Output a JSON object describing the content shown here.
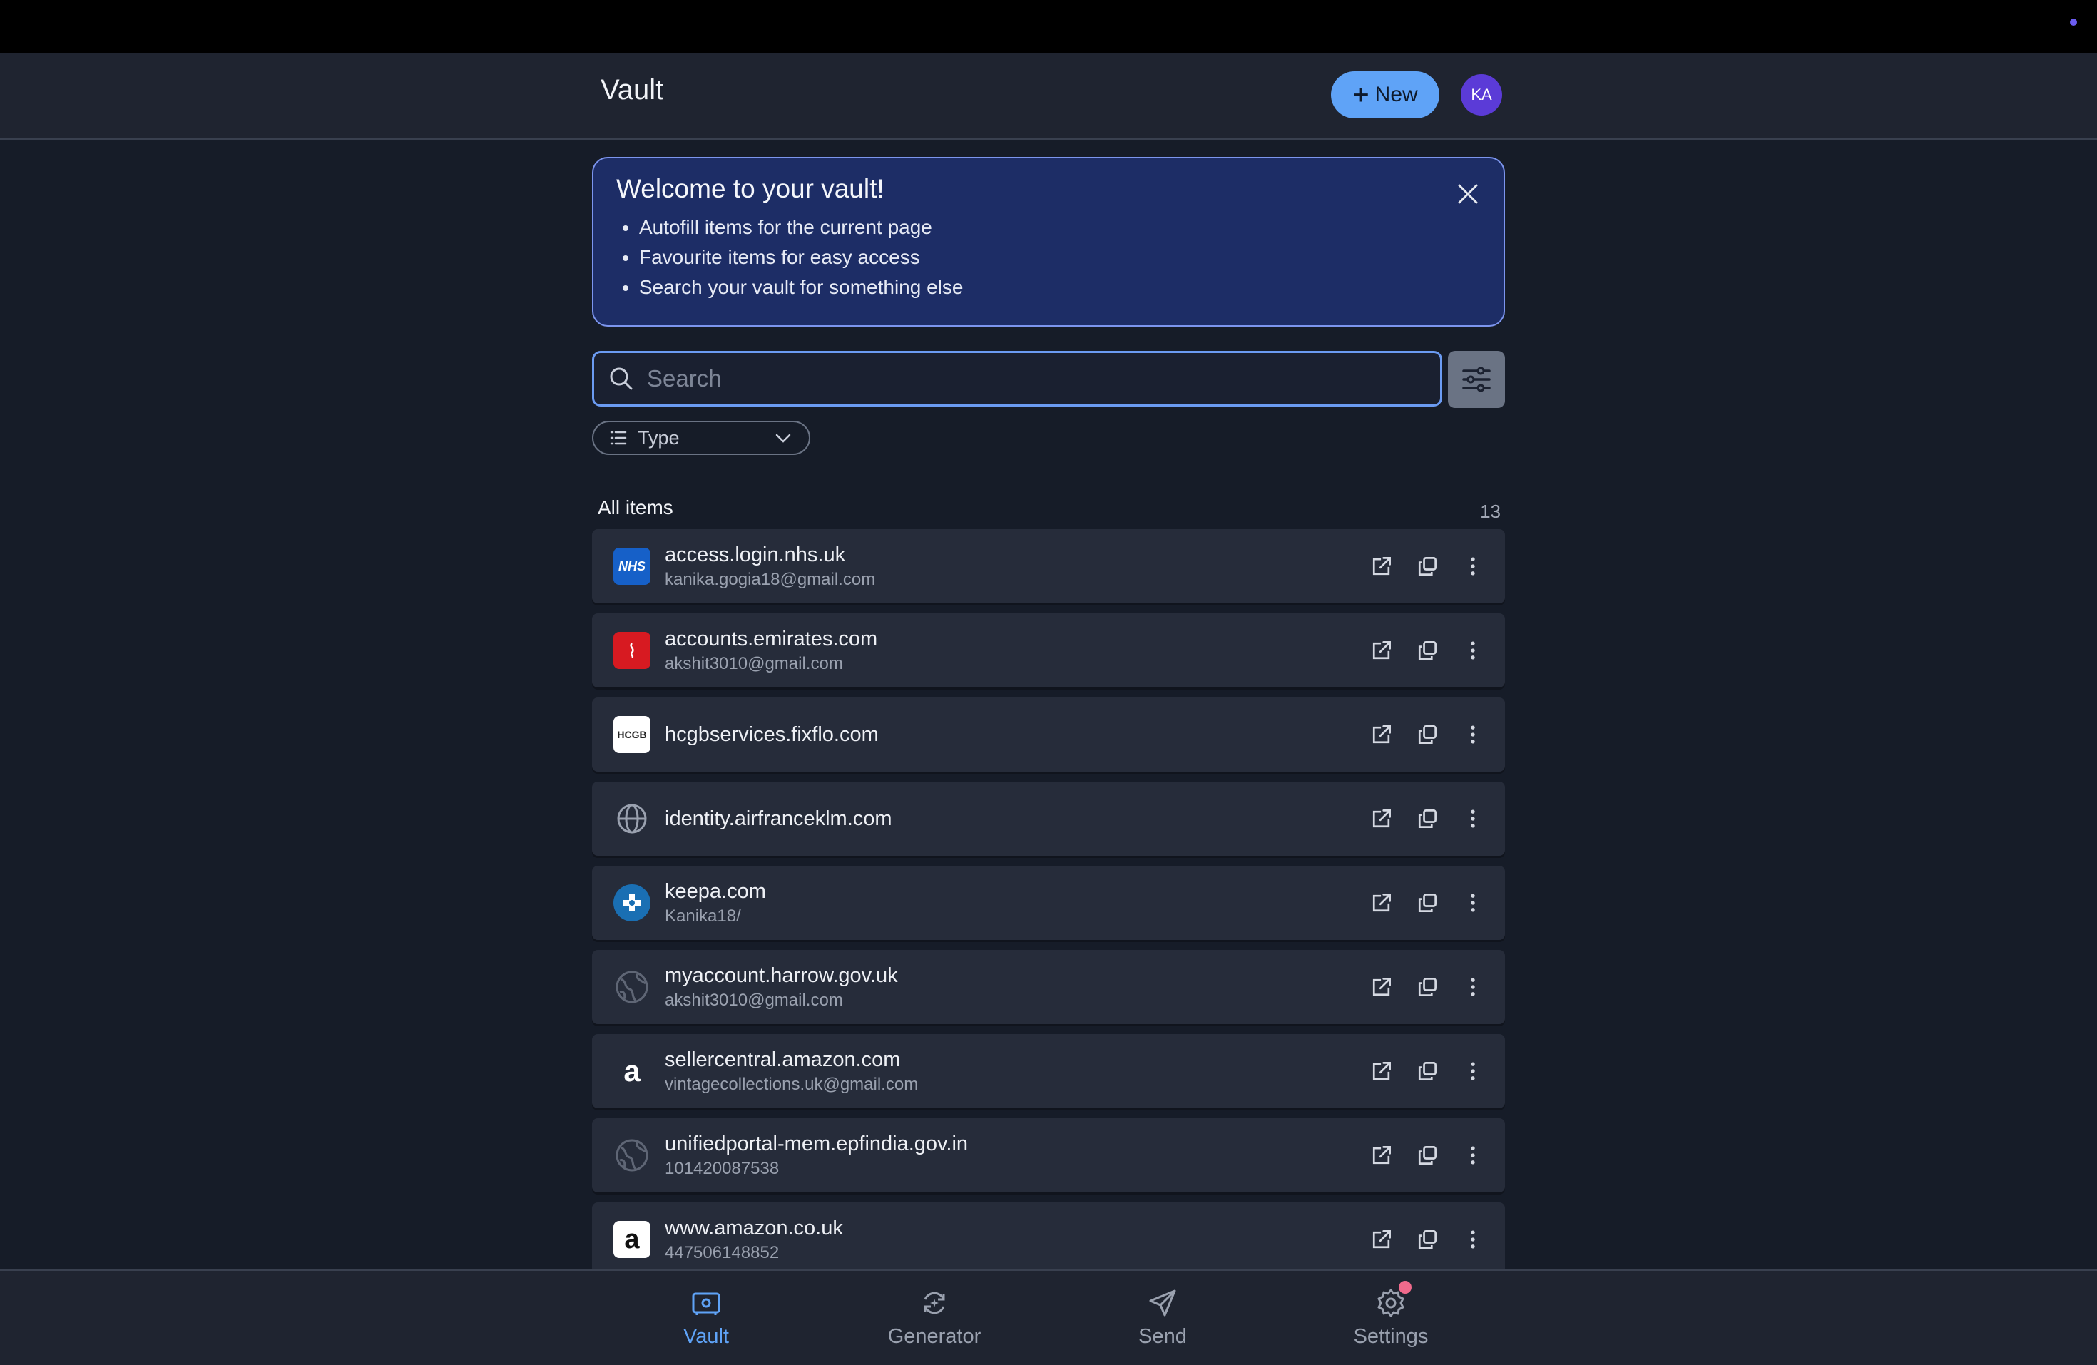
{
  "header": {
    "title": "Vault",
    "new_label": "New",
    "avatar_initials": "KA"
  },
  "welcome": {
    "title": "Welcome to your vault!",
    "bullets": [
      "Autofill items for the current page",
      "Favourite items for easy access",
      "Search your vault for something else"
    ]
  },
  "search": {
    "placeholder": "Search",
    "value": ""
  },
  "filter": {
    "type_label": "Type"
  },
  "list": {
    "label": "All items",
    "count": "13",
    "items": [
      {
        "name": "access.login.nhs.uk",
        "sub": "kanika.gogia18@gmail.com",
        "icon": "nhs-logo-icon",
        "icon_text": "NHS"
      },
      {
        "name": "accounts.emirates.com",
        "sub": "akshit3010@gmail.com",
        "icon": "emirates-logo-icon"
      },
      {
        "name": "hcgbservices.fixflo.com",
        "sub": "",
        "icon": "hcgb-logo-icon",
        "icon_text": "HCGB"
      },
      {
        "name": "identity.airfranceklm.com",
        "sub": "",
        "icon": "globe-icon"
      },
      {
        "name": "keepa.com",
        "sub": "Kanika18/",
        "icon": "keepa-logo-icon"
      },
      {
        "name": "myaccount.harrow.gov.uk",
        "sub": "akshit3010@gmail.com",
        "icon": "globe-placeholder-icon"
      },
      {
        "name": "sellercentral.amazon.com",
        "sub": "vintagecollections.uk@gmail.com",
        "icon": "amazon-logo-icon",
        "icon_text": "a"
      },
      {
        "name": "unifiedportal-mem.epfindia.gov.in",
        "sub": "101420087538",
        "icon": "globe-placeholder-icon"
      },
      {
        "name": "www.amazon.co.uk",
        "sub": "447506148852",
        "icon": "amazon-logo-icon",
        "icon_text": "a"
      }
    ]
  },
  "nav": {
    "vault": "Vault",
    "generator": "Generator",
    "send": "Send",
    "settings": "Settings"
  },
  "colors": {
    "accent": "#5fa3f7",
    "background": "#161c28",
    "welcome_bg": "#1d2d66",
    "avatar": "#5b3bd7"
  }
}
